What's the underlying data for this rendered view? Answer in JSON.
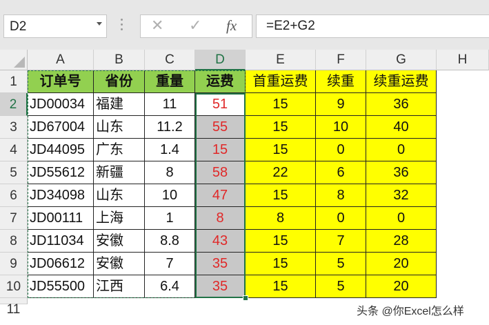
{
  "formula_bar": {
    "name_box": "D2",
    "formula": "=E2+G2",
    "cancel_icon": "✕",
    "enter_icon": "✓",
    "fx_icon": "fx"
  },
  "columns": [
    "A",
    "B",
    "C",
    "D",
    "E",
    "F",
    "G",
    "H"
  ],
  "rows": [
    "1",
    "2",
    "3",
    "4",
    "5",
    "6",
    "7",
    "8",
    "9",
    "10",
    "11"
  ],
  "headers": {
    "A": "订单号",
    "B": "省份",
    "C": "重量",
    "D": "运费",
    "E": "首重运费",
    "F": "续重",
    "G": "续重运费"
  },
  "data_rows": [
    {
      "A": "JD00034",
      "B": "福建",
      "C": "11",
      "D": "51",
      "E": "15",
      "F": "9",
      "G": "36"
    },
    {
      "A": "JD67004",
      "B": "山东",
      "C": "11.2",
      "D": "55",
      "E": "15",
      "F": "10",
      "G": "40"
    },
    {
      "A": "JD44095",
      "B": "广东",
      "C": "1.4",
      "D": "15",
      "E": "15",
      "F": "0",
      "G": "0"
    },
    {
      "A": "JD55612",
      "B": "新疆",
      "C": "8",
      "D": "58",
      "E": "22",
      "F": "6",
      "G": "36"
    },
    {
      "A": "JD34098",
      "B": "山东",
      "C": "10",
      "D": "47",
      "E": "15",
      "F": "8",
      "G": "32"
    },
    {
      "A": "JD00111",
      "B": "上海",
      "C": "1",
      "D": "8",
      "E": "8",
      "F": "0",
      "G": "0"
    },
    {
      "A": "JD11034",
      "B": "安徽",
      "C": "8.8",
      "D": "43",
      "E": "15",
      "F": "7",
      "G": "28"
    },
    {
      "A": "JD06612",
      "B": "安徽",
      "C": "7",
      "D": "35",
      "E": "15",
      "F": "5",
      "G": "20"
    },
    {
      "A": "JD55500",
      "B": "江西",
      "C": "6.4",
      "D": "35",
      "E": "15",
      "F": "5",
      "G": "20"
    }
  ],
  "watermark": "头条 @你Excel怎么样",
  "colors": {
    "header_green": "#92d050",
    "highlight_yellow": "#ffff00",
    "result_red": "#e02828",
    "selection_green": "#217346"
  }
}
